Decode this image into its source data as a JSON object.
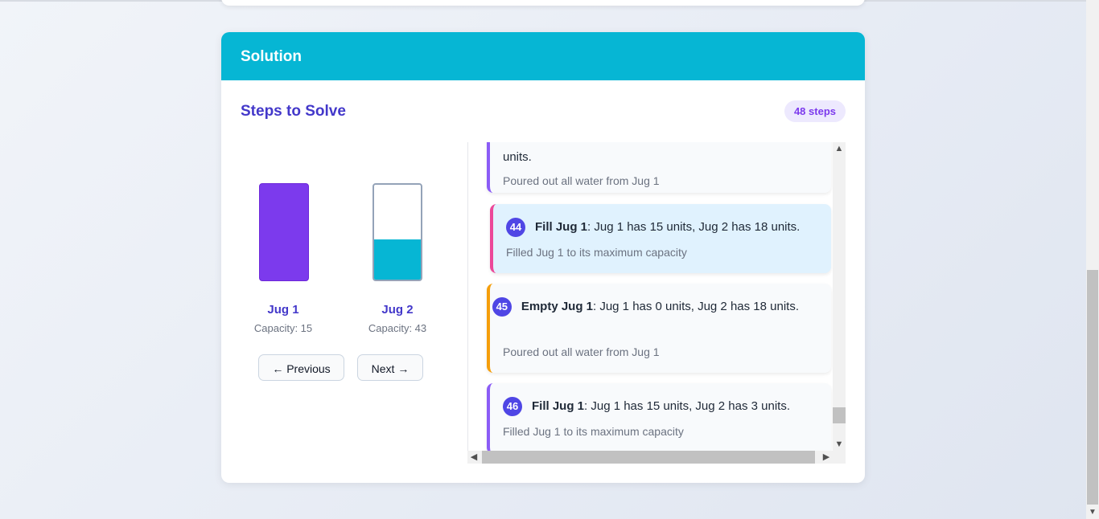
{
  "header": {
    "title": "Solution"
  },
  "steps_title": "Steps to Solve",
  "steps_badge": "48 steps",
  "jugs": [
    {
      "name": "Jug 1",
      "capacity_label": "Capacity: 15",
      "fill_fraction": 1.0,
      "color": "#7c3aed"
    },
    {
      "name": "Jug 2",
      "capacity_label": "Capacity: 43",
      "fill_fraction": 0.42,
      "color": "#06b6d4"
    }
  ],
  "buttons": {
    "previous": "← Previous",
    "next": "Next →"
  },
  "steps": [
    {
      "partial_text": "units.",
      "desc": "Poured out all water from Jug 1"
    },
    {
      "number": "44",
      "action": "Fill Jug 1",
      "text": ": Jug 1 has 15 units, Jug 2 has 18 units.",
      "desc": "Filled Jug 1 to its maximum capacity"
    },
    {
      "number": "45",
      "action": "Empty Jug 1",
      "text": ": Jug 1 has 0 units, Jug 2 has 18 units.",
      "desc": "Poured out all water from Jug 1"
    },
    {
      "number": "46",
      "action": "Fill Jug 1",
      "text": ": Jug 1 has 15 units, Jug 2 has 3 units.",
      "desc": "Filled Jug 1 to its maximum capacity"
    }
  ],
  "scroll_icons": {
    "up": "chevron-up-icon",
    "down": "chevron-down-icon",
    "left": "chevron-left-icon",
    "right": "chevron-right-icon"
  }
}
